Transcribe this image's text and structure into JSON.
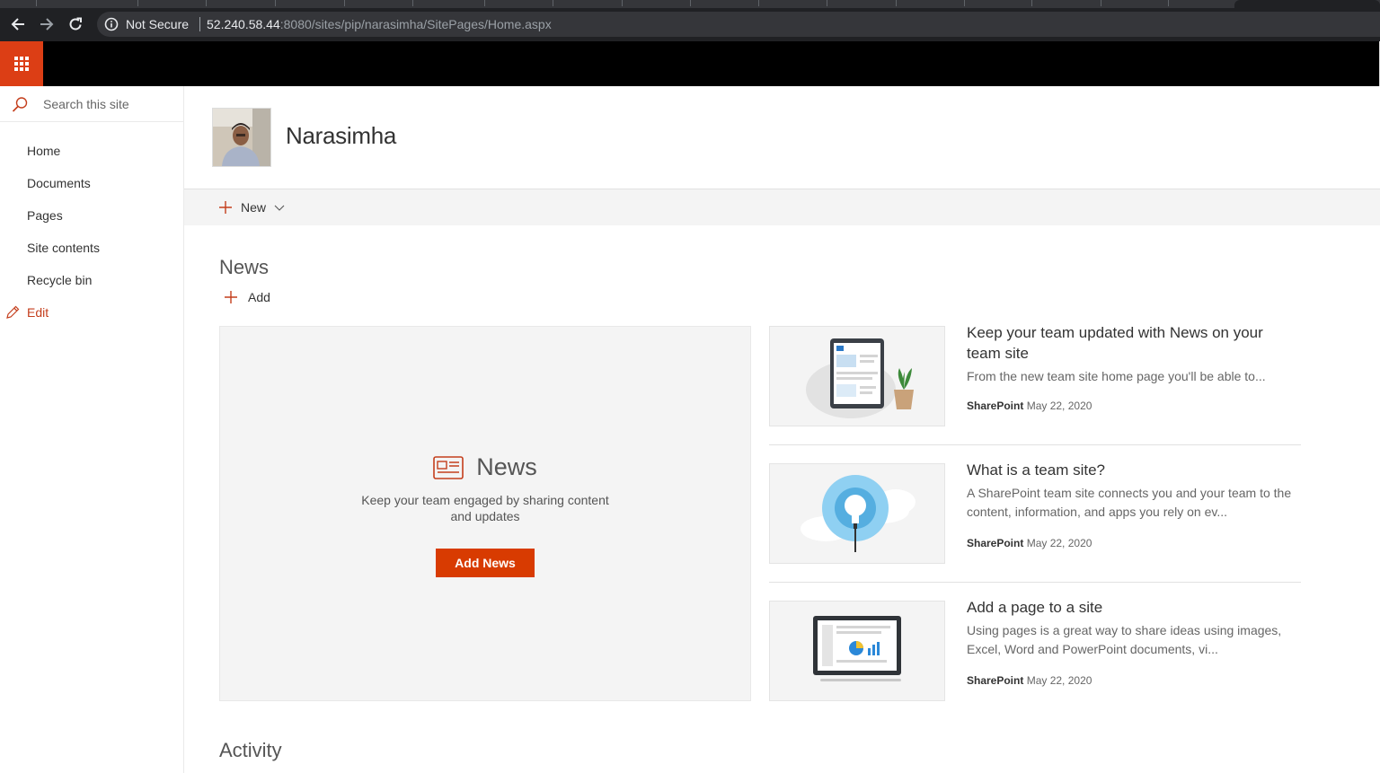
{
  "browser": {
    "security_label": "Not Secure",
    "url_host": "52.240.58.44",
    "url_path": ":8080/sites/pip/narasimha/SitePages/Home.aspx"
  },
  "search": {
    "placeholder": "Search this site"
  },
  "left_nav": {
    "items": [
      {
        "label": "Home"
      },
      {
        "label": "Documents"
      },
      {
        "label": "Pages"
      },
      {
        "label": "Site contents"
      },
      {
        "label": "Recycle bin"
      }
    ],
    "edit_label": "Edit"
  },
  "site": {
    "title": "Narasimha"
  },
  "command_bar": {
    "new_label": "New"
  },
  "news": {
    "heading": "News",
    "add_label": "Add",
    "placeholder": {
      "title": "News",
      "description": "Keep your team engaged by sharing content and updates",
      "button_label": "Add News"
    },
    "cards": [
      {
        "title": "Keep your team updated with News on your team site",
        "description": "From the new team site home page you'll be able to...",
        "author": "SharePoint",
        "date": "May 22, 2020",
        "thumb_icon": "tablet-plant-illustration"
      },
      {
        "title": "What is a team site?",
        "description": "A SharePoint team site connects you and your team to the content, information, and apps you rely on ev...",
        "author": "SharePoint",
        "date": "May 22, 2020",
        "thumb_icon": "lightbulb-cloud-illustration"
      },
      {
        "title": "Add a page to a site",
        "description": "Using pages is a great way to share ideas using images, Excel, Word and PowerPoint documents, vi...",
        "author": "SharePoint",
        "date": "May 22, 2020",
        "thumb_icon": "laptop-chart-illustration"
      }
    ]
  },
  "activity": {
    "heading": "Activity"
  },
  "colors": {
    "brand_orange": "#dc3e15",
    "accent_red": "#c43e1c",
    "button_red": "#d83b01",
    "suite_bar": "#000000"
  }
}
